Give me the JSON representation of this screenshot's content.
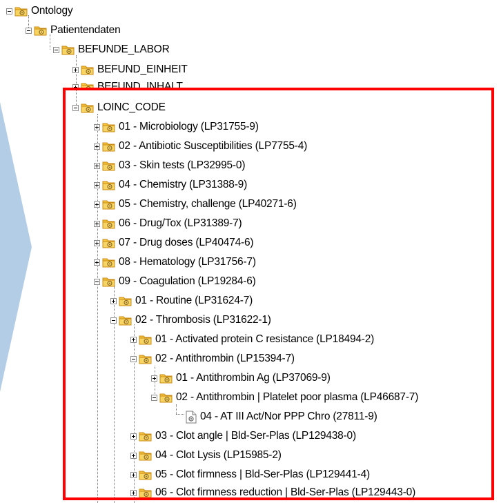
{
  "tree": {
    "nodes": [
      {
        "label": "Ontology",
        "state": "expanded",
        "icon": "folder-icon"
      },
      {
        "label": "Patientendaten",
        "state": "expanded",
        "icon": "folder-icon"
      },
      {
        "label": "BEFUNDE_LABOR",
        "state": "expanded",
        "icon": "folder-icon"
      },
      {
        "label": "BEFUND_EINHEIT",
        "state": "collapsed",
        "icon": "folder-icon"
      },
      {
        "label": "BEFUND_INHALT",
        "state": "collapsed",
        "icon": "folder-icon"
      },
      {
        "label": "LOINC_CODE",
        "state": "expanded",
        "icon": "folder-icon"
      },
      {
        "label": "01 - Microbiology (LP31755-9)",
        "state": "collapsed",
        "icon": "folder-icon"
      },
      {
        "label": "02 - Antibiotic Susceptibilities (LP7755-4)",
        "state": "collapsed",
        "icon": "folder-icon"
      },
      {
        "label": "03 - Skin tests (LP32995-0)",
        "state": "collapsed",
        "icon": "folder-icon"
      },
      {
        "label": "04 - Chemistry (LP31388-9)",
        "state": "collapsed",
        "icon": "folder-icon"
      },
      {
        "label": "05 - Chemistry, challenge (LP40271-6)",
        "state": "collapsed",
        "icon": "folder-icon"
      },
      {
        "label": "06 - Drug/Tox (LP31389-7)",
        "state": "collapsed",
        "icon": "folder-icon"
      },
      {
        "label": "07 - Drug doses (LP40474-6)",
        "state": "collapsed",
        "icon": "folder-icon"
      },
      {
        "label": "08 - Hematology (LP31756-7)",
        "state": "collapsed",
        "icon": "folder-icon"
      },
      {
        "label": "09 - Coagulation (LP19284-6)",
        "state": "expanded",
        "icon": "folder-icon"
      },
      {
        "label": "01 - Routine (LP31624-7)",
        "state": "collapsed",
        "icon": "folder-icon"
      },
      {
        "label": "02 - Thrombosis (LP31622-1)",
        "state": "expanded",
        "icon": "folder-icon"
      },
      {
        "label": "01 - Activated protein C resistance (LP18494-2)",
        "state": "collapsed",
        "icon": "folder-icon"
      },
      {
        "label": "02 - Antithrombin (LP15394-7)",
        "state": "expanded",
        "icon": "folder-icon"
      },
      {
        "label": "01 - Antithrombin Ag (LP37069-9)",
        "state": "collapsed",
        "icon": "folder-icon"
      },
      {
        "label": "02 - Antithrombin | Platelet poor plasma (LP46687-7)",
        "state": "expanded",
        "icon": "folder-icon"
      },
      {
        "label": "04 - AT III Act/Nor PPP Chro (27811-9)",
        "state": "leaf",
        "icon": "document-icon"
      },
      {
        "label": "03 - Clot angle | Bld-Ser-Plas (LP129438-0)",
        "state": "collapsed",
        "icon": "folder-icon"
      },
      {
        "label": "04 - Clot Lysis (LP15985-2)",
        "state": "collapsed",
        "icon": "folder-icon"
      },
      {
        "label": "05 - Clot firmness | Bld-Ser-Plas (LP129441-4)",
        "state": "collapsed",
        "icon": "folder-icon"
      },
      {
        "label": "06 - Clot firmness reduction | Bld-Ser-Plas (LP129443-0)",
        "state": "collapsed",
        "icon": "folder-icon"
      }
    ]
  },
  "colors": {
    "highlight_border": "#ff0000",
    "arrow_fill": "#b4cde6",
    "folder_fill": "#f5c542",
    "folder_edge": "#c98a10",
    "folder_emblem": "#8a6a2a"
  }
}
